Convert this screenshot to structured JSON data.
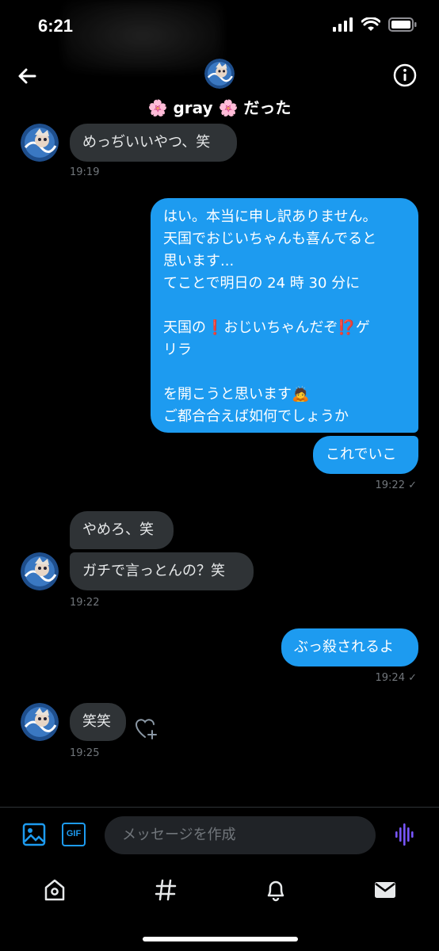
{
  "status_bar": {
    "time": "6:21"
  },
  "header": {
    "name": "🌸 gray 🌸 だった"
  },
  "messages": [
    {
      "dir": "in",
      "text": "めっぢいいやつ、笑"
    },
    {
      "dir": "out",
      "text": "はい。本当に申し訳ありません。\n天国でおじいちゃんも喜んでると\n思います...\nてことで明日の 24 時 30 分に\n\n天国の❗おじいちゃんだぞ⁉️ゲ\nリラ\n\nを開こうと思います🙇\nご都合合えば如何でしょうか"
    },
    {
      "dir": "out",
      "text": "これでいこ"
    },
    {
      "dir": "in",
      "text": "やめろ、笑"
    },
    {
      "dir": "in",
      "text": "ガチで言っとんの？笑"
    },
    {
      "dir": "out",
      "text": "ぶっ殺されるよ"
    },
    {
      "dir": "in",
      "text": "笑笑"
    }
  ],
  "timestamps": [
    {
      "text": "19:19"
    },
    {
      "text": "19:22 ✓"
    },
    {
      "text": "19:22"
    },
    {
      "text": "19:24 ✓"
    },
    {
      "text": "19:25"
    }
  ],
  "composer": {
    "placeholder": "メッセージを作成"
  },
  "icons": {
    "back": "arrow-left-icon",
    "info": "info-icon",
    "image": "image-icon",
    "gif": "GIF",
    "voice": "voice-wave-icon",
    "like": "heart-plus-icon",
    "home": "home-icon",
    "explore": "hashtag-icon",
    "notifications": "bell-icon",
    "messages": "envelope-icon"
  },
  "colors": {
    "accent": "#1d9bf0",
    "bubble_in": "#2f3336",
    "voice_accent": "#7856ff"
  }
}
